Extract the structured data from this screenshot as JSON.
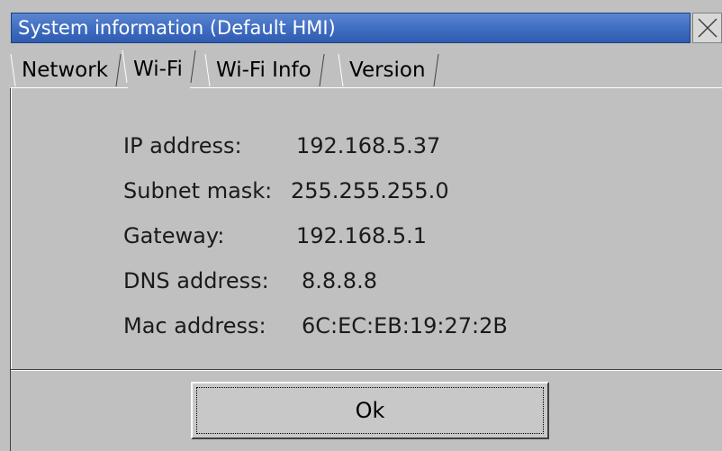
{
  "window": {
    "title": "System information (Default HMI)"
  },
  "tabs": [
    {
      "label": "Network",
      "active": false
    },
    {
      "label": "Wi-Fi",
      "active": true
    },
    {
      "label": "Wi-Fi Info",
      "active": false
    },
    {
      "label": "Version",
      "active": false
    }
  ],
  "info": {
    "ip_label": "IP address:",
    "ip_value": "192.168.5.37",
    "subnet_label": "Subnet mask:",
    "subnet_value": "255.255.255.0",
    "gateway_label": "Gateway:",
    "gateway_value": "192.168.5.1",
    "dns_label": "DNS address:",
    "dns_value": "8.8.8.8",
    "mac_label": "Mac address:",
    "mac_value": "6C:EC:EB:19:27:2B"
  },
  "footer": {
    "ok_label": "Ok"
  },
  "icons": {
    "close": "close-icon"
  },
  "colors": {
    "titlebar": "#3e6cc0",
    "background": "#c0c0c0"
  }
}
